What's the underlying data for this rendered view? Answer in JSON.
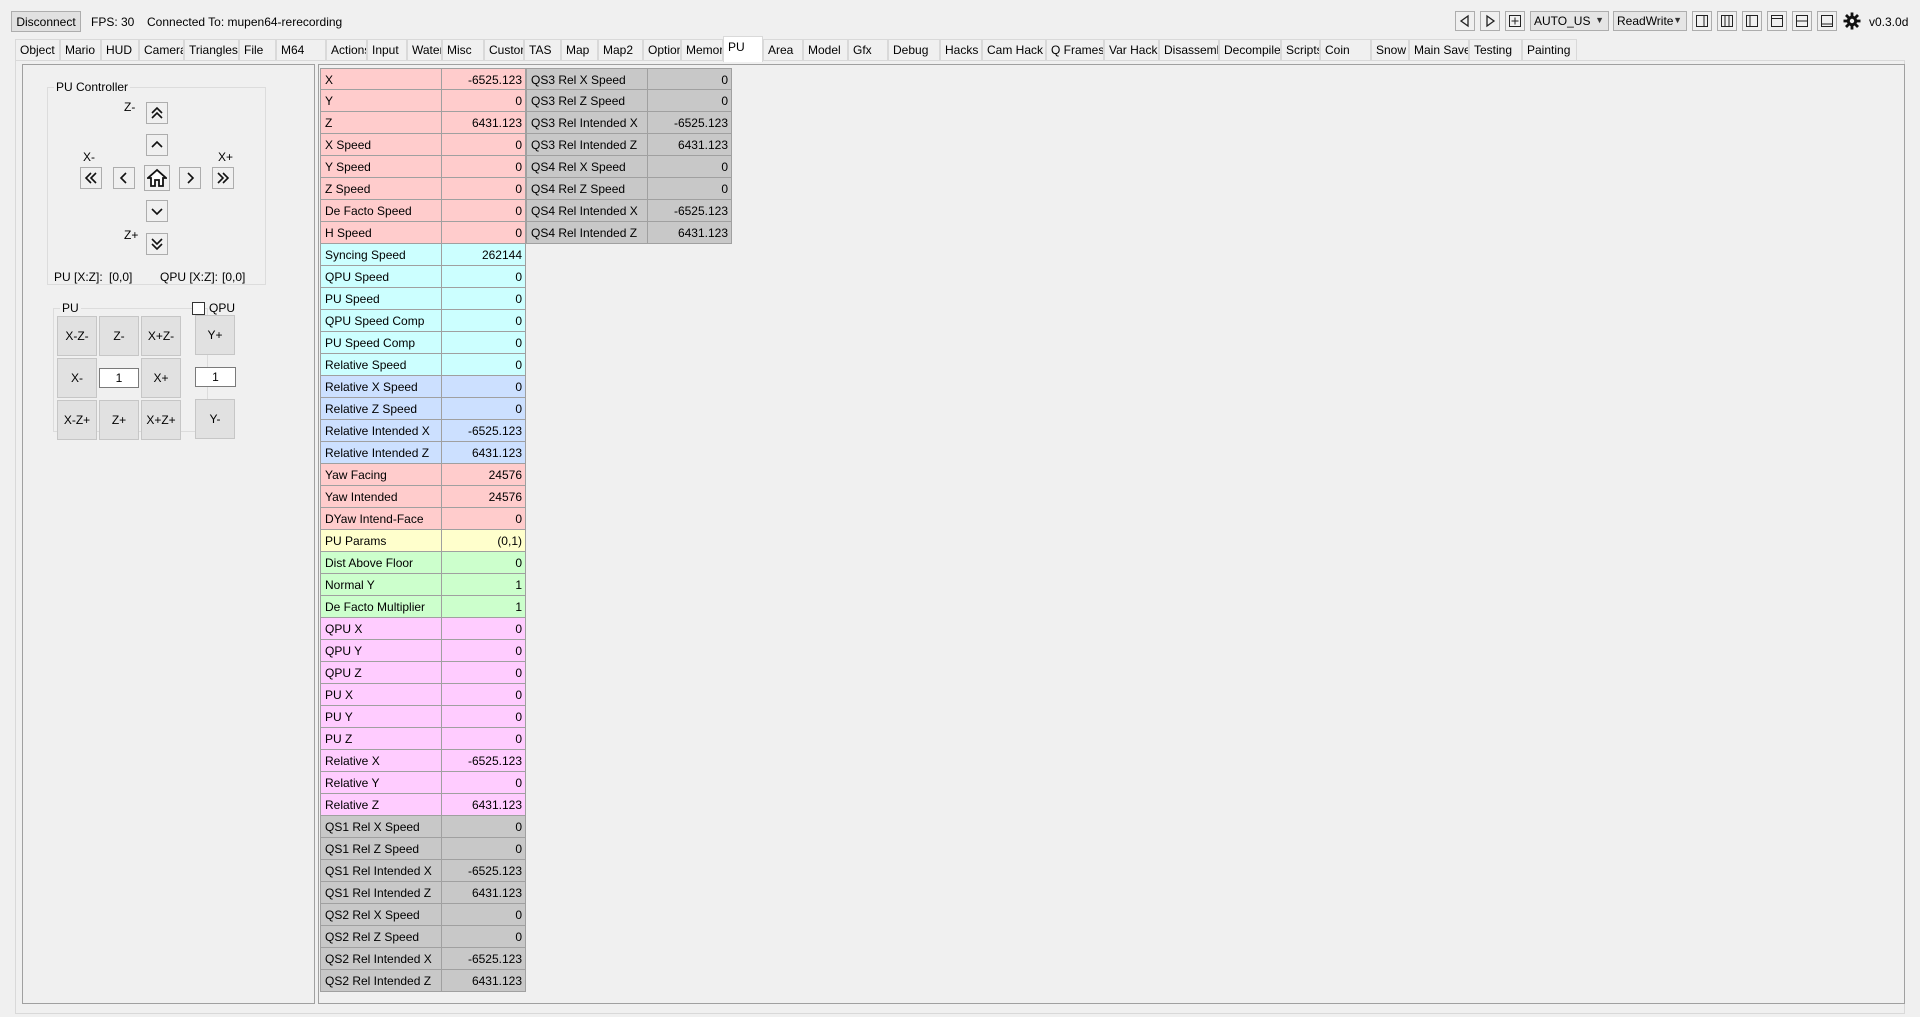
{
  "topbar": {
    "disconnect_label": "Disconnect",
    "fps_text": "FPS: 30",
    "connection_text": "Connected To: mupen64-rerecording",
    "region_value": "AUTO_US",
    "access_value": "ReadWrite",
    "version": "v0.3.0d",
    "icons": [
      "back-arrow-icon",
      "forward-arrow-icon",
      "add-icon",
      "layout-1-icon",
      "layout-2-icon",
      "layout-3-icon",
      "layout-4-icon",
      "layout-5-icon",
      "layout-6-icon",
      "gear-icon"
    ]
  },
  "tabs": [
    "Object",
    "Mario",
    "HUD",
    "Camera",
    "Triangles",
    "File",
    "M64",
    "Actions",
    "Input",
    "Water",
    "Misc",
    "Custom",
    "TAS",
    "Map",
    "Map2",
    "Options",
    "Memory",
    "PU",
    "Area",
    "Model",
    "Gfx",
    "Debug",
    "Hacks",
    "Cam Hack",
    "Q Frames",
    "Var Hack",
    "Disassembly",
    "Decompiler",
    "Scripts",
    "Coin",
    "Snow",
    "Main Save",
    "Testing",
    "Painting"
  ],
  "active_tab": "PU",
  "pu_controller": {
    "title": "PU Controller",
    "z_minus": "Z-",
    "z_plus": "Z+",
    "x_minus": "X-",
    "x_plus": "X+",
    "pu_xz_label": "PU [X:Z]:",
    "pu_xz_value": "[0,0]",
    "qpu_xz_label": "QPU [X:Z]:",
    "qpu_xz_value": "[0,0]"
  },
  "pu_group": {
    "title": "PU",
    "qpu_checkbox_label": "QPU",
    "qpu_checked": false,
    "buttons": {
      "xminus_zminus": "X-Z-",
      "zminus": "Z-",
      "xplus_zminus": "X+Z-",
      "yplus": "Y+",
      "xminus": "X-",
      "xplus": "X+",
      "xminus_zplus": "X-Z+",
      "zplus": "Z+",
      "xplus_zplus": "X+Z+",
      "yminus": "Y-"
    },
    "xz_step": "1",
    "y_step": "1"
  },
  "colors": {
    "pink": "#ffcccc",
    "cyan": "#ccffff",
    "blue": "#cce0ff",
    "yellow": "#ffffcc",
    "green": "#ccffcc",
    "magenta": "#ffccff",
    "gray": "#c8c8c8"
  },
  "grid": {
    "column1": [
      {
        "name": "X",
        "value": "-6525.123",
        "color": "pink"
      },
      {
        "name": "Y",
        "value": "0",
        "color": "pink"
      },
      {
        "name": "Z",
        "value": "6431.123",
        "color": "pink"
      },
      {
        "name": "X Speed",
        "value": "0",
        "color": "pink"
      },
      {
        "name": "Y Speed",
        "value": "0",
        "color": "pink"
      },
      {
        "name": "Z Speed",
        "value": "0",
        "color": "pink"
      },
      {
        "name": "De Facto Speed",
        "value": "0",
        "color": "pink"
      },
      {
        "name": "H Speed",
        "value": "0",
        "color": "pink"
      },
      {
        "name": "Syncing Speed",
        "value": "262144",
        "color": "cyan"
      },
      {
        "name": "QPU Speed",
        "value": "0",
        "color": "cyan"
      },
      {
        "name": "PU Speed",
        "value": "0",
        "color": "cyan"
      },
      {
        "name": "QPU Speed Comp",
        "value": "0",
        "color": "cyan"
      },
      {
        "name": "PU Speed Comp",
        "value": "0",
        "color": "cyan"
      },
      {
        "name": "Relative Speed",
        "value": "0",
        "color": "cyan"
      },
      {
        "name": "Relative X Speed",
        "value": "0",
        "color": "blue"
      },
      {
        "name": "Relative Z Speed",
        "value": "0",
        "color": "blue"
      },
      {
        "name": "Relative Intended X",
        "value": "-6525.123",
        "color": "blue"
      },
      {
        "name": "Relative Intended Z",
        "value": "6431.123",
        "color": "blue"
      },
      {
        "name": "Yaw Facing",
        "value": "24576",
        "color": "pink"
      },
      {
        "name": "Yaw Intended",
        "value": "24576",
        "color": "pink"
      },
      {
        "name": "DYaw Intend-Face",
        "value": "0",
        "color": "pink"
      },
      {
        "name": "PU Params",
        "value": "(0,1)",
        "color": "yellow"
      },
      {
        "name": "Dist Above Floor",
        "value": "0",
        "color": "green"
      },
      {
        "name": "Normal Y",
        "value": "1",
        "color": "green"
      },
      {
        "name": "De Facto Multiplier",
        "value": "1",
        "color": "green"
      },
      {
        "name": "QPU X",
        "value": "0",
        "color": "magenta"
      },
      {
        "name": "QPU Y",
        "value": "0",
        "color": "magenta"
      },
      {
        "name": "QPU Z",
        "value": "0",
        "color": "magenta"
      },
      {
        "name": "PU X",
        "value": "0",
        "color": "magenta"
      },
      {
        "name": "PU Y",
        "value": "0",
        "color": "magenta"
      },
      {
        "name": "PU Z",
        "value": "0",
        "color": "magenta"
      },
      {
        "name": "Relative X",
        "value": "-6525.123",
        "color": "magenta"
      },
      {
        "name": "Relative Y",
        "value": "0",
        "color": "magenta"
      },
      {
        "name": "Relative Z",
        "value": "6431.123",
        "color": "magenta"
      },
      {
        "name": "QS1 Rel X Speed",
        "value": "0",
        "color": "gray"
      },
      {
        "name": "QS1 Rel Z Speed",
        "value": "0",
        "color": "gray"
      },
      {
        "name": "QS1 Rel Intended X",
        "value": "-6525.123",
        "color": "gray"
      },
      {
        "name": "QS1 Rel Intended Z",
        "value": "6431.123",
        "color": "gray"
      },
      {
        "name": "QS2 Rel X Speed",
        "value": "0",
        "color": "gray"
      },
      {
        "name": "QS2 Rel Z Speed",
        "value": "0",
        "color": "gray"
      },
      {
        "name": "QS2 Rel Intended X",
        "value": "-6525.123",
        "color": "gray"
      },
      {
        "name": "QS2 Rel Intended Z",
        "value": "6431.123",
        "color": "gray"
      }
    ],
    "column2": [
      {
        "name": "QS3 Rel X Speed",
        "value": "0",
        "color": "gray"
      },
      {
        "name": "QS3 Rel Z Speed",
        "value": "0",
        "color": "gray"
      },
      {
        "name": "QS3 Rel Intended X",
        "value": "-6525.123",
        "color": "gray"
      },
      {
        "name": "QS3 Rel Intended Z",
        "value": "6431.123",
        "color": "gray"
      },
      {
        "name": "QS4 Rel X Speed",
        "value": "0",
        "color": "gray"
      },
      {
        "name": "QS4 Rel Z Speed",
        "value": "0",
        "color": "gray"
      },
      {
        "name": "QS4 Rel Intended X",
        "value": "-6525.123",
        "color": "gray"
      },
      {
        "name": "QS4 Rel Intended Z",
        "value": "6431.123",
        "color": "gray"
      }
    ]
  }
}
